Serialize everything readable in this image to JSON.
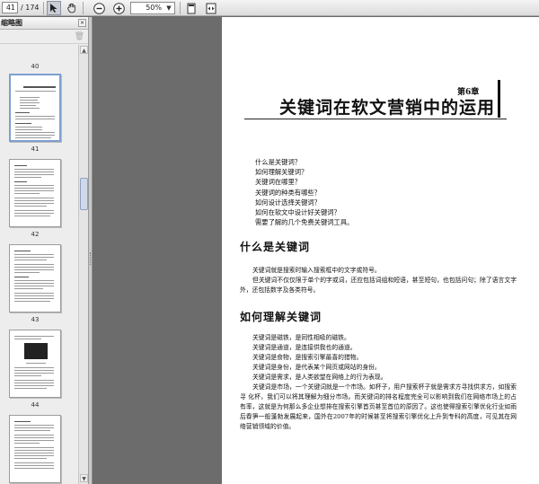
{
  "toolbar": {
    "current_page": "41",
    "total_pages": "/ 174",
    "zoom": "50%"
  },
  "panel": {
    "title": "缩略图",
    "thumbnails": [
      {
        "label": "40"
      },
      {
        "label": "41"
      },
      {
        "label": "42"
      },
      {
        "label": "43"
      },
      {
        "label": "44"
      }
    ]
  },
  "document": {
    "chapter_number": "第6章",
    "chapter_title": "关键词在软文营销中的运用",
    "questions": [
      "什么是关键词？",
      "如何理解关键词？",
      "关键词在哪里？",
      "关键词的种类有哪些？",
      "如何设计选择关键词？",
      "如何在软文中设计好关键词？",
      "需要了解的几个免费关键词工具。"
    ],
    "section1": {
      "heading": "什么是关键词",
      "p1": "关键词就是搜索时输入搜索框中的文字或符号。",
      "p2": "但关键词不仅仅限于单个的字或词，还应包括词组和短语，甚至短句，也包括问句；除了语言文字外，还包括数字及各类符号。"
    },
    "section2": {
      "heading": "如何理解关键词",
      "lines": [
        "关键词是磁铁，是同性相吸的磁铁。",
        "关键词是通道，是连接供我也的通道。",
        "关键词是食物，是搜索引擎最喜的猎物。",
        "关键词是身份，是代表某个网页或网站的身份。",
        "关键词是需求，是人类欲望在网络上的行为表现。"
      ],
      "p_last": "关键词是市场，一个关键词就是一个市场。如杯子，用户搜索杯子就是需求方寻找供求方，如搜索寻 化杯，我们可以将其理解为细分市场。而关键词的排名程度完全可以影响到我们在网络市场上的占有率，这就是为何那么多企业想排在搜索引擎首页甚至首位的原因了。这也使得搜索引擎优化行业如雨后春笋一般蓬勃发展起来，国外在2007年的时候甚至将搜索引擎优化上升到专科的高度，可见其在网络营销领域的价值。"
    }
  }
}
